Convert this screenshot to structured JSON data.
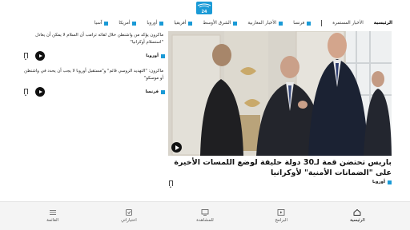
{
  "brand": {
    "logo_text": "24",
    "accent": "#1a9ad6"
  },
  "nav": {
    "items": [
      {
        "label": "الرئيسية",
        "active": true
      },
      {
        "label": "الأخبار المستمرة"
      },
      {
        "label": "فرنسا"
      },
      {
        "label": "الأخبار المغاربية"
      },
      {
        "label": "الشرق الأوسط"
      },
      {
        "label": "أفريقيا"
      },
      {
        "label": "أوروبا"
      },
      {
        "label": "أمريكا"
      },
      {
        "label": "آسيا"
      }
    ]
  },
  "hero": {
    "title": "باريس تحتضن قمة لـ30 دولة حليفة لوضع اللمسات الأخيرة على \"الضمانات الأمنية\" لأوكرانيا",
    "category": "أوروبا"
  },
  "side": [
    {
      "title": "ماكرون يؤكد من واشنطن خلال لقائه ترامب أن السلام لا يمكن أن يعادل \"استسلام أوكرانيا\"",
      "category": "أوروبا"
    },
    {
      "title": "ماكرون: \"التهديد الروسي قائم\" و\"مستقبل أوروبا لا يجب أن يحدد في واشنطن أو موسكو\"",
      "category": "فرنسا"
    }
  ],
  "tabbar": {
    "items": [
      {
        "label": "الرئيسية",
        "icon": "home-icon",
        "active": true
      },
      {
        "label": "البرامج",
        "icon": "programs-icon"
      },
      {
        "label": "للمشاهدة",
        "icon": "tv-icon"
      },
      {
        "label": "اختياراتي",
        "icon": "favorites-icon"
      },
      {
        "label": "القائمة",
        "icon": "menu-icon"
      }
    ]
  }
}
